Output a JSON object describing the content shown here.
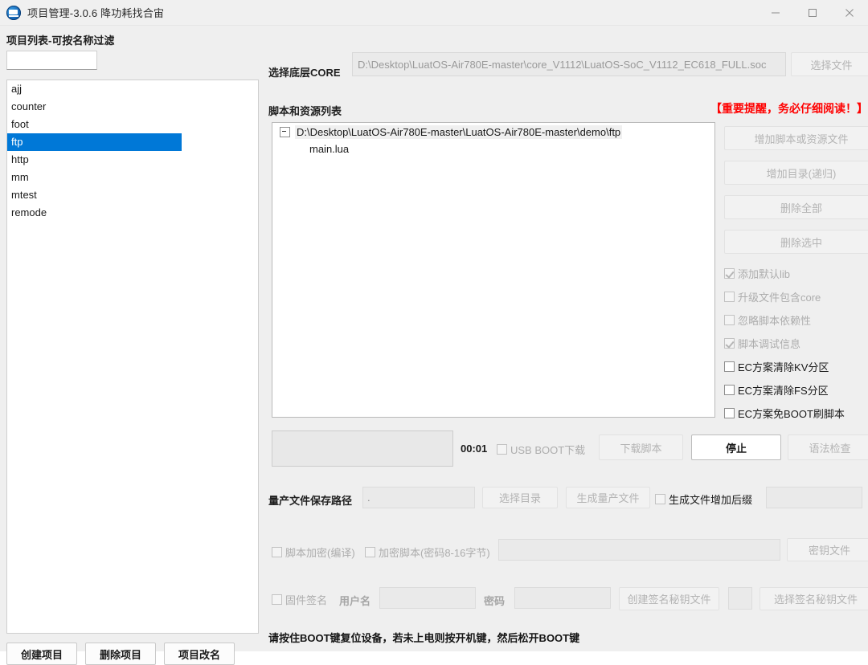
{
  "window": {
    "title": "项目管理-3.0.6 降功耗找合宙",
    "icon": "app-logo-icon",
    "controls": {
      "minimize": "minimize-icon",
      "maximize": "maximize-icon",
      "close": "close-icon"
    }
  },
  "left_panel": {
    "label": "项目列表-可按名称过滤",
    "filter_value": "",
    "filter_placeholder": "",
    "items": [
      {
        "label": "ajj",
        "selected": false
      },
      {
        "label": "counter",
        "selected": false
      },
      {
        "label": "foot",
        "selected": false
      },
      {
        "label": "ftp",
        "selected": true
      },
      {
        "label": "http",
        "selected": false
      },
      {
        "label": "mm",
        "selected": false
      },
      {
        "label": "mtest",
        "selected": false
      },
      {
        "label": "remode",
        "selected": false
      }
    ],
    "buttons": {
      "create": "创建项目",
      "delete": "删除项目",
      "rename": "项目改名"
    }
  },
  "right_panel": {
    "core": {
      "label": "选择底层CORE",
      "path_value": "D:\\Desktop\\LuatOS-Air780E-master\\core_V1112\\LuatOS-SoC_V1112_EC618_FULL.soc",
      "choose_file_button": "选择文件"
    },
    "script_section": {
      "label": "脚本和资源列表",
      "warning": "【重要提醒，务必仔细阅读！】",
      "warning_color": "#ff0000",
      "tree": {
        "root": "D:\\Desktop\\LuatOS-Air780E-master\\LuatOS-Air780E-master\\demo\\ftp",
        "children": [
          "main.lua"
        ]
      }
    },
    "side_buttons": [
      {
        "label": "增加脚本或资源文件",
        "enabled": false
      },
      {
        "label": "增加目录(递归)",
        "enabled": false
      },
      {
        "label": "删除全部",
        "enabled": false
      },
      {
        "label": "删除选中",
        "enabled": false
      }
    ],
    "side_checkboxes": [
      {
        "label": "添加默认lib",
        "checked": true,
        "enabled": false
      },
      {
        "label": "升级文件包含core",
        "checked": false,
        "enabled": false
      },
      {
        "label": "忽略脚本依赖性",
        "checked": false,
        "enabled": false
      },
      {
        "label": "脚本调试信息",
        "checked": true,
        "enabled": false
      },
      {
        "label": "EC方案清除KV分区",
        "checked": false,
        "enabled": true
      },
      {
        "label": "EC方案清除FS分区",
        "checked": false,
        "enabled": true
      },
      {
        "label": "EC方案免BOOT刷脚本",
        "checked": false,
        "enabled": true
      }
    ],
    "download_row": {
      "timer": "00:01",
      "usb_boot_label": "USB BOOT下载",
      "usb_boot_checked": false,
      "download_button": "下载脚本",
      "download_enabled": false,
      "stop_button": "停止",
      "stop_enabled": true,
      "syntax_button": "语法检查",
      "syntax_enabled": false
    },
    "mass_production": {
      "label": "量产文件保存路径",
      "path_value": ".",
      "choose_dir_button": "选择目录",
      "generate_button": "生成量产文件",
      "suffix_checkbox_label": "生成文件增加后缀",
      "suffix_checked": false,
      "suffix_value": ""
    },
    "encryption": {
      "compile_checkbox_label": "脚本加密(编译)",
      "compile_checked": false,
      "encrypt_checkbox_label": "加密脚本(密码8-16字节)",
      "encrypt_checked": false,
      "password_value": "",
      "key_file_button": "密钥文件"
    },
    "signature": {
      "firmware_sign_label": "固件签名",
      "firmware_sign_checked": false,
      "username_label": "用户名",
      "username_value": "",
      "password_label": "密码",
      "password_value": "",
      "create_key_button": "创建签名秘钥文件",
      "select_key_button": "选择签名秘钥文件"
    },
    "boot_tip": "请按住BOOT键复位设备，若未上电则按开机键，然后松开BOOT键"
  }
}
